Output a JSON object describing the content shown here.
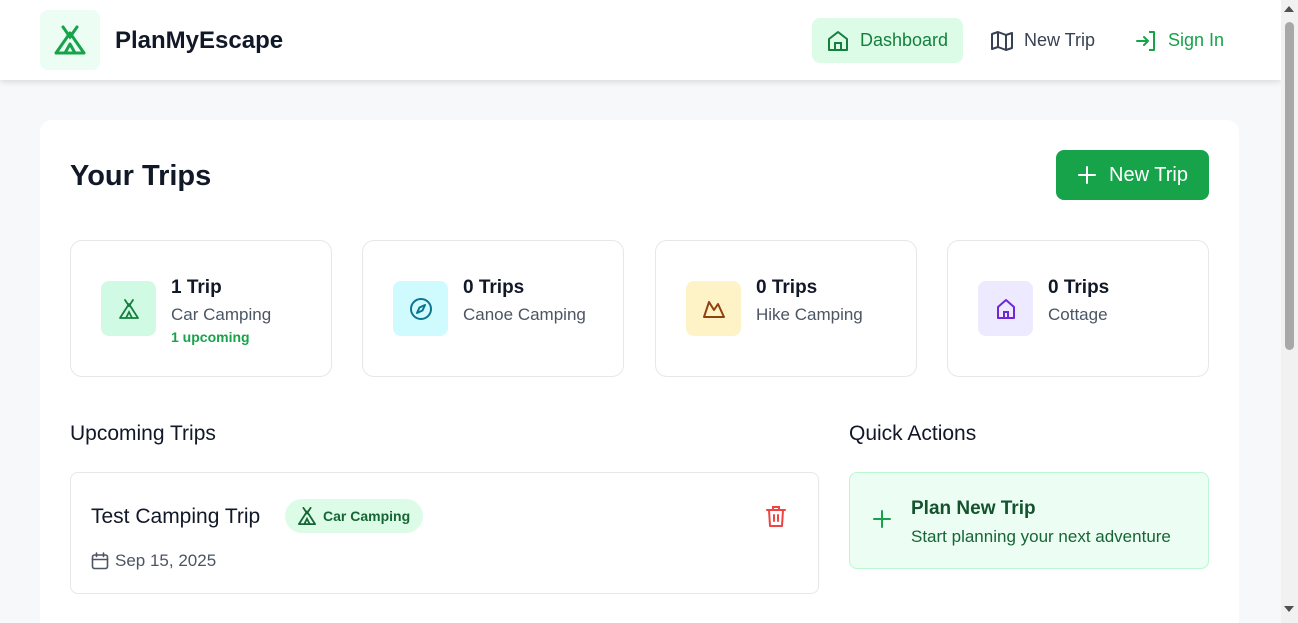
{
  "header": {
    "brand": "PlanMyEscape",
    "nav": {
      "dashboard": "Dashboard",
      "new_trip": "New Trip",
      "sign_in": "Sign In"
    }
  },
  "main": {
    "title": "Your Trips",
    "new_trip_button": "New Trip",
    "stats": [
      {
        "count": "1 Trip",
        "label": "Car Camping",
        "sub": "1 upcoming",
        "icon": "tent-icon",
        "bg": "#d1fae5",
        "fg": "#15803d"
      },
      {
        "count": "0 Trips",
        "label": "Canoe Camping",
        "sub": "",
        "icon": "compass-icon",
        "bg": "#cffafe",
        "fg": "#0e7490"
      },
      {
        "count": "0 Trips",
        "label": "Hike Camping",
        "sub": "",
        "icon": "mountain-icon",
        "bg": "#fef3c7",
        "fg": "#b45309"
      },
      {
        "count": "0 Trips",
        "label": "Cottage",
        "sub": "",
        "icon": "house-icon",
        "bg": "#ede9fe",
        "fg": "#6d28d9"
      }
    ],
    "upcoming": {
      "title": "Upcoming Trips",
      "trips": [
        {
          "name": "Test Camping Trip",
          "badge": "Car Camping",
          "date": "Sep 15, 2025"
        }
      ]
    },
    "quick_actions": {
      "title": "Quick Actions",
      "items": [
        {
          "title": "Plan New Trip",
          "subtitle": "Start planning your next adventure"
        }
      ]
    }
  },
  "colors": {
    "brand_green": "#16a34a",
    "delete_red": "#ef4444"
  }
}
